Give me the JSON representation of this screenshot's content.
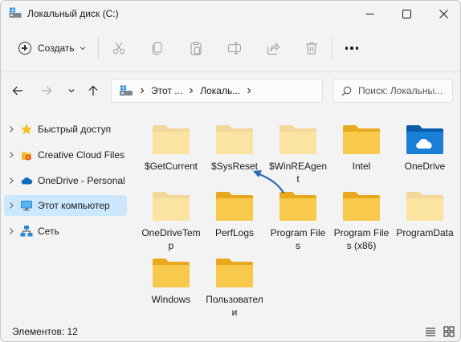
{
  "window": {
    "title": "Локальный диск (C:)"
  },
  "commandbar": {
    "create_label": "Создать",
    "icons": [
      "cut-icon",
      "copy-icon",
      "paste-icon",
      "rename-icon",
      "share-icon",
      "delete-icon",
      "more-icon"
    ]
  },
  "navigation": {
    "breadcrumbs": [
      "Этот ...",
      "Локаль..."
    ],
    "search_placeholder": "Поиск: Локальны..."
  },
  "sidebar": {
    "items": [
      {
        "label": "Быстрый доступ",
        "icon": "star-icon",
        "selected": false
      },
      {
        "label": "Creative Cloud Files",
        "icon": "creative-cloud-icon",
        "selected": false
      },
      {
        "label": "OneDrive - Personal",
        "icon": "onedrive-cloud-icon",
        "selected": false
      },
      {
        "label": "Этот компьютер",
        "icon": "computer-icon",
        "selected": true
      },
      {
        "label": "Сеть",
        "icon": "network-icon",
        "selected": false
      }
    ]
  },
  "folders": [
    {
      "name": "$GetCurrent",
      "style": "faded"
    },
    {
      "name": "$SysReset",
      "style": "faded"
    },
    {
      "name": "$WinREAgent",
      "style": "faded"
    },
    {
      "name": "Intel",
      "style": "normal"
    },
    {
      "name": "OneDrive",
      "style": "onedrive"
    },
    {
      "name": "OneDriveTemp",
      "style": "faded"
    },
    {
      "name": "PerfLogs",
      "style": "normal"
    },
    {
      "name": "Program Files",
      "style": "normal"
    },
    {
      "name": "Program Files (x86)",
      "style": "normal"
    },
    {
      "name": "ProgramData",
      "style": "faded"
    },
    {
      "name": "Windows",
      "style": "normal"
    },
    {
      "name": "Пользователи",
      "style": "normal"
    }
  ],
  "status": {
    "items_count": "Элементов: 12"
  },
  "colors": {
    "selection": "#cce8ff",
    "folder": "#f8c94b",
    "folder_faded": "#fbe3a1",
    "arrow": "#2b6cb0"
  }
}
